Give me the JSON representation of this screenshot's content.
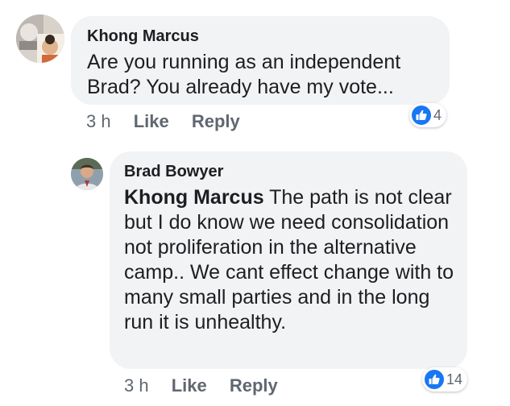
{
  "comments": [
    {
      "author": "Khong Marcus",
      "text": "Are you running as an independent Brad? You already have my vote...",
      "time": "3 h",
      "like_label": "Like",
      "reply_label": "Reply",
      "reaction_count": "4",
      "avatar_icon": "profile-photo-children",
      "reaction_icon": "thumbs-up-icon"
    },
    {
      "author": "Brad Bowyer",
      "mention": "Khong Marcus",
      "text": "The path is not clear but I do know we need consolidation not  proliferation in the alternative camp.. We cant effect change with to many small parties and in the long run it is unhealthy.",
      "time": "3 h",
      "like_label": "Like",
      "reply_label": "Reply",
      "reaction_count": "14",
      "avatar_icon": "profile-photo-man",
      "reaction_icon": "thumbs-up-icon"
    }
  ],
  "colors": {
    "bubble": "#f2f3f5",
    "text": "#1c1e21",
    "meta": "#606770",
    "like_blue": "#1877f2"
  }
}
